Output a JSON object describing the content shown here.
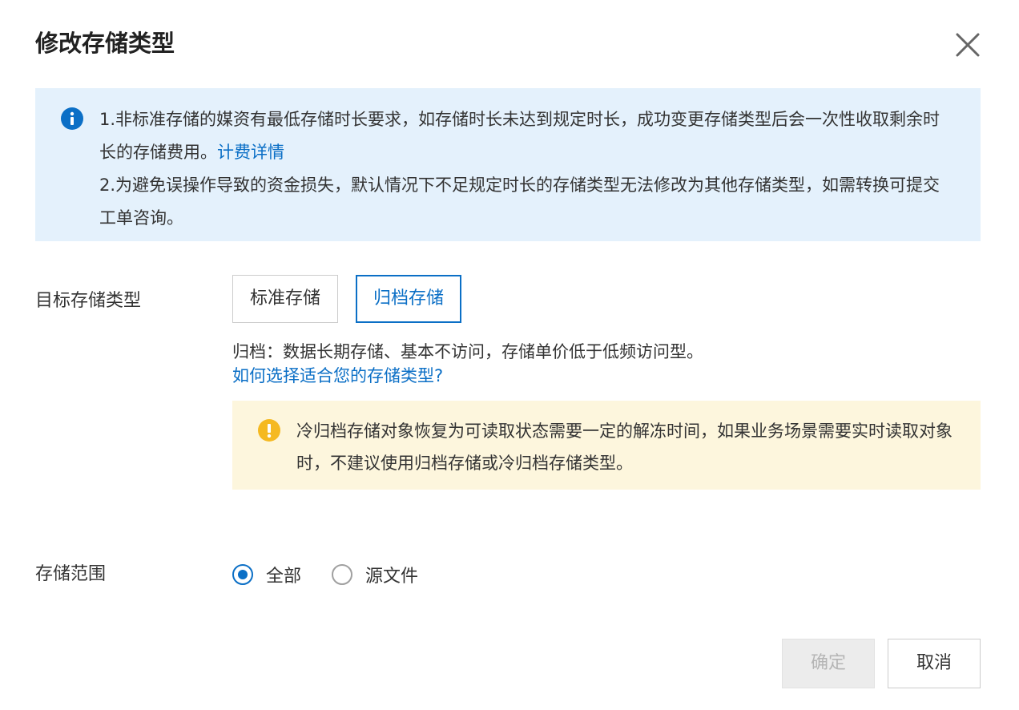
{
  "dialog": {
    "title": "修改存储类型",
    "close_icon": "close-icon"
  },
  "info": {
    "icon": "info-icon",
    "line1": "1.非标准存储的媒资有最低存储时长要求，如存储时长未达到规定时长，成功变更存储类型后会一次性收取剩余时长的存储费用。",
    "link": "计费详情",
    "line2": "2.为避免误操作导致的资金损失，默认情况下不足规定时长的存储类型无法修改为其他存储类型，如需转换可提交工单咨询。"
  },
  "target_type": {
    "label": "目标存储类型",
    "options": [
      {
        "label": "标准存储",
        "selected": false
      },
      {
        "label": "归档存储",
        "selected": true
      }
    ],
    "description": "归档：数据长期存储、基本不访问，存储单价低于低频访问型。",
    "help_link": "如何选择适合您的存储类型?"
  },
  "warning": {
    "icon": "warning-icon",
    "text": "冷归档存储对象恢复为可读取状态需要一定的解冻时间，如果业务场景需要实时读取对象时，不建议使用归档存储或冷归档存储类型。"
  },
  "scope": {
    "label": "存储范围",
    "options": [
      {
        "label": "全部",
        "checked": true
      },
      {
        "label": "源文件",
        "checked": false
      }
    ]
  },
  "footer": {
    "ok_label": "确定",
    "ok_disabled": true,
    "cancel_label": "取消"
  },
  "colors": {
    "accent": "#0b6fc6",
    "info_bg": "#e4f1fc",
    "warn_bg": "#fdf6dd",
    "warn_icon": "#f5b921"
  }
}
